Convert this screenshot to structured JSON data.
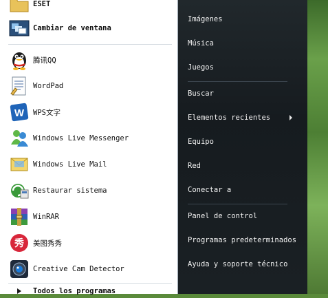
{
  "left_panel": {
    "items": [
      {
        "label": "ESET",
        "bold": true,
        "icon": "folder-icon"
      },
      {
        "label": "Cambiar de ventana",
        "bold": true,
        "icon": "switch-windows-icon"
      },
      {
        "label": "腾讯QQ",
        "icon": "qq-penguin-icon"
      },
      {
        "label": "WordPad",
        "icon": "wordpad-icon"
      },
      {
        "label": "WPS文字",
        "icon": "wps-writer-icon"
      },
      {
        "label": "Windows Live Messenger",
        "icon": "messenger-icon"
      },
      {
        "label": "Windows Live Mail",
        "icon": "live-mail-icon"
      },
      {
        "label": "Restaurar sistema",
        "icon": "system-restore-icon"
      },
      {
        "label": "WinRAR",
        "icon": "winrar-icon"
      },
      {
        "label": "美图秀秀",
        "icon": "meitu-icon"
      },
      {
        "label": "Creative Cam Detector",
        "icon": "webcam-icon"
      }
    ],
    "all_programs": "Todos los programas"
  },
  "right_panel": {
    "items": [
      {
        "label": "Imágenes"
      },
      {
        "label": "Música"
      },
      {
        "label": "Juegos"
      },
      {
        "label": "Buscar"
      },
      {
        "label": "Elementos recientes",
        "has_submenu": true
      },
      {
        "label": "Equipo"
      },
      {
        "label": "Red"
      },
      {
        "label": "Conectar a"
      },
      {
        "label": "Panel de control"
      },
      {
        "label": "Programas predeterminados"
      },
      {
        "label": "Ayuda y soporte técnico"
      }
    ]
  },
  "colors": {
    "left_bg": "#ffffff",
    "right_bg": "#1c2226",
    "right_text": "#f2f2f2"
  }
}
